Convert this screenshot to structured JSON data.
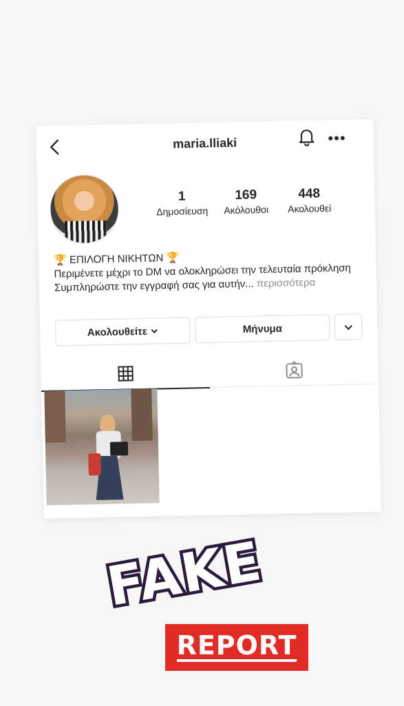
{
  "header": {
    "username": "maria.lliaki"
  },
  "stats": [
    {
      "value": "1",
      "label": "Δημοσίευση"
    },
    {
      "value": "169",
      "label": "Ακόλουθοι"
    },
    {
      "value": "448",
      "label": "Ακολουθεί"
    }
  ],
  "bio": {
    "line1": "🏆 ΕΠΙΛΟΓΗ ΝΙΚΗΤΩΝ 🏆",
    "line2": "Περιμένετε μέχρι το DM να ολοκληρώσει την τελευταία πρόκληση",
    "line3": "Συμπληρώστε την εγγραφή σας για αυτήν...",
    "more": "περισσότερα"
  },
  "buttons": {
    "following": "Ακολουθείτε",
    "message": "Μήνυμα"
  },
  "stickers": {
    "fake": "FAKE",
    "report": "REPORT"
  },
  "icons": {
    "back": "chevron-left-icon",
    "bell": "bell-icon",
    "more": "more-horizontal-icon",
    "grid": "grid-icon",
    "tagged": "tagged-person-icon"
  }
}
